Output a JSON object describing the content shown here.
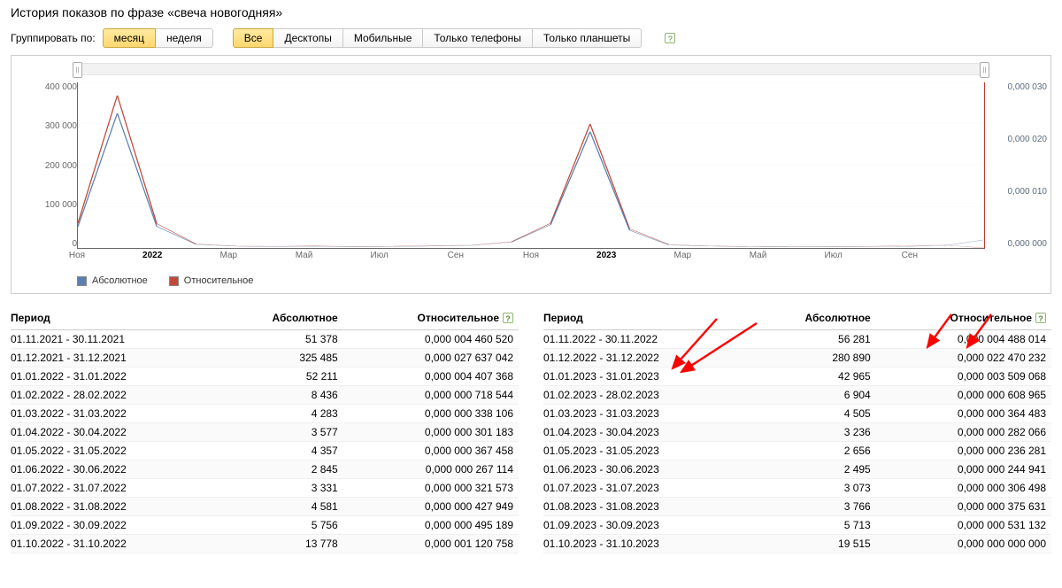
{
  "title": "История показов по фразе «свеча новогодняя»",
  "group_by_label": "Группировать по:",
  "group_by": [
    "месяц",
    "неделя"
  ],
  "group_by_active": 0,
  "device_filters": [
    "Все",
    "Десктопы",
    "Мобильные",
    "Только телефоны",
    "Только планшеты"
  ],
  "device_active": 0,
  "legend": {
    "abs": "Абсолютное",
    "rel": "Относительное"
  },
  "legend_colors": {
    "abs": "#5b7fb0",
    "rel": "#c04a3a"
  },
  "left_axis": [
    "0",
    "100 000",
    "200 000",
    "300 000",
    "400 000"
  ],
  "right_axis": [
    "0,000 000",
    "0,000 010",
    "0,000 020",
    "0,000 030"
  ],
  "x_ticks": [
    {
      "pos": 0.0,
      "label": "Ноя"
    },
    {
      "pos": 0.083,
      "label": "2022",
      "year": true
    },
    {
      "pos": 0.167,
      "label": "Мар"
    },
    {
      "pos": 0.25,
      "label": "Май"
    },
    {
      "pos": 0.333,
      "label": "Июл"
    },
    {
      "pos": 0.417,
      "label": "Сен"
    },
    {
      "pos": 0.5,
      "label": "Ноя"
    },
    {
      "pos": 0.583,
      "label": "2023",
      "year": true
    },
    {
      "pos": 0.667,
      "label": "Мар"
    },
    {
      "pos": 0.75,
      "label": "Май"
    },
    {
      "pos": 0.833,
      "label": "Июл"
    },
    {
      "pos": 0.917,
      "label": "Сен"
    }
  ],
  "table_headers": {
    "period": "Период",
    "abs": "Абсолютное",
    "rel": "Относительное"
  },
  "table_left": [
    {
      "p": "01.11.2021 - 30.11.2021",
      "a": "51 378",
      "r": "0,000 004 460 520"
    },
    {
      "p": "01.12.2021 - 31.12.2021",
      "a": "325 485",
      "r": "0,000 027 637 042"
    },
    {
      "p": "01.01.2022 - 31.01.2022",
      "a": "52 211",
      "r": "0,000 004 407 368"
    },
    {
      "p": "01.02.2022 - 28.02.2022",
      "a": "8 436",
      "r": "0,000 000 718 544"
    },
    {
      "p": "01.03.2022 - 31.03.2022",
      "a": "4 283",
      "r": "0,000 000 338 106"
    },
    {
      "p": "01.04.2022 - 30.04.2022",
      "a": "3 577",
      "r": "0,000 000 301 183"
    },
    {
      "p": "01.05.2022 - 31.05.2022",
      "a": "4 357",
      "r": "0,000 000 367 458"
    },
    {
      "p": "01.06.2022 - 30.06.2022",
      "a": "2 845",
      "r": "0,000 000 267 114"
    },
    {
      "p": "01.07.2022 - 31.07.2022",
      "a": "3 331",
      "r": "0,000 000 321 573"
    },
    {
      "p": "01.08.2022 - 31.08.2022",
      "a": "4 581",
      "r": "0,000 000 427 949"
    },
    {
      "p": "01.09.2022 - 30.09.2022",
      "a": "5 756",
      "r": "0,000 000 495 189"
    },
    {
      "p": "01.10.2022 - 31.10.2022",
      "a": "13 778",
      "r": "0,000 001 120 758"
    }
  ],
  "table_right": [
    {
      "p": "01.11.2022 - 30.11.2022",
      "a": "56 281",
      "r": "0,000 004 488 014"
    },
    {
      "p": "01.12.2022 - 31.12.2022",
      "a": "280 890",
      "r": "0,000 022 470 232"
    },
    {
      "p": "01.01.2023 - 31.01.2023",
      "a": "42 965",
      "r": "0,000 003 509 068"
    },
    {
      "p": "01.02.2023 - 28.02.2023",
      "a": "6 904",
      "r": "0,000 000 608 965"
    },
    {
      "p": "01.03.2023 - 31.03.2023",
      "a": "4 505",
      "r": "0,000 000 364 483"
    },
    {
      "p": "01.04.2023 - 30.04.2023",
      "a": "3 236",
      "r": "0,000 000 282 066"
    },
    {
      "p": "01.05.2023 - 31.05.2023",
      "a": "2 656",
      "r": "0,000 000 236 281"
    },
    {
      "p": "01.06.2023 - 30.06.2023",
      "a": "2 495",
      "r": "0,000 000 244 941"
    },
    {
      "p": "01.07.2023 - 31.07.2023",
      "a": "3 073",
      "r": "0,000 000 306 498"
    },
    {
      "p": "01.08.2023 - 31.08.2023",
      "a": "3 766",
      "r": "0,000 000 375 631"
    },
    {
      "p": "01.09.2023 - 30.09.2023",
      "a": "5 713",
      "r": "0,000 000 531 132"
    },
    {
      "p": "01.10.2023 - 31.10.2023",
      "a": "19 515",
      "r": "0,000 000 000 000"
    }
  ],
  "chart_data": {
    "type": "line",
    "title": "История показов по фразе «свеча новогодняя»",
    "xlabel": "",
    "ylabel_left": "Абсолютное",
    "ylabel_right": "Относительное",
    "ylim_left": [
      0,
      400000
    ],
    "ylim_right": [
      0,
      3e-05
    ],
    "x": [
      "2021-11",
      "2021-12",
      "2022-01",
      "2022-02",
      "2022-03",
      "2022-04",
      "2022-05",
      "2022-06",
      "2022-07",
      "2022-08",
      "2022-09",
      "2022-10",
      "2022-11",
      "2022-12",
      "2023-01",
      "2023-02",
      "2023-03",
      "2023-04",
      "2023-05",
      "2023-06",
      "2023-07",
      "2023-08",
      "2023-09",
      "2023-10"
    ],
    "series": [
      {
        "name": "Абсолютное",
        "axis": "left",
        "color": "#5b7fb0",
        "values": [
          51378,
          325485,
          52211,
          8436,
          4283,
          3577,
          4357,
          2845,
          3331,
          4581,
          5756,
          13778,
          56281,
          280890,
          42965,
          6904,
          4505,
          3236,
          2656,
          2495,
          3073,
          3766,
          5713,
          19515
        ]
      },
      {
        "name": "Относительное",
        "axis": "right",
        "color": "#c04a3a",
        "values": [
          4.46052e-06,
          2.7637042e-05,
          4.407368e-06,
          7.18544e-07,
          3.38106e-07,
          3.01183e-07,
          3.67458e-07,
          2.67114e-07,
          3.21573e-07,
          4.27949e-07,
          4.95189e-07,
          1.120758e-06,
          4.488014e-06,
          2.247023e-05,
          3.509068e-06,
          6.08965e-07,
          3.64483e-07,
          2.82066e-07,
          2.36281e-07,
          2.44941e-07,
          3.06498e-07,
          3.75631e-07,
          5.31132e-07,
          0
        ]
      }
    ]
  }
}
